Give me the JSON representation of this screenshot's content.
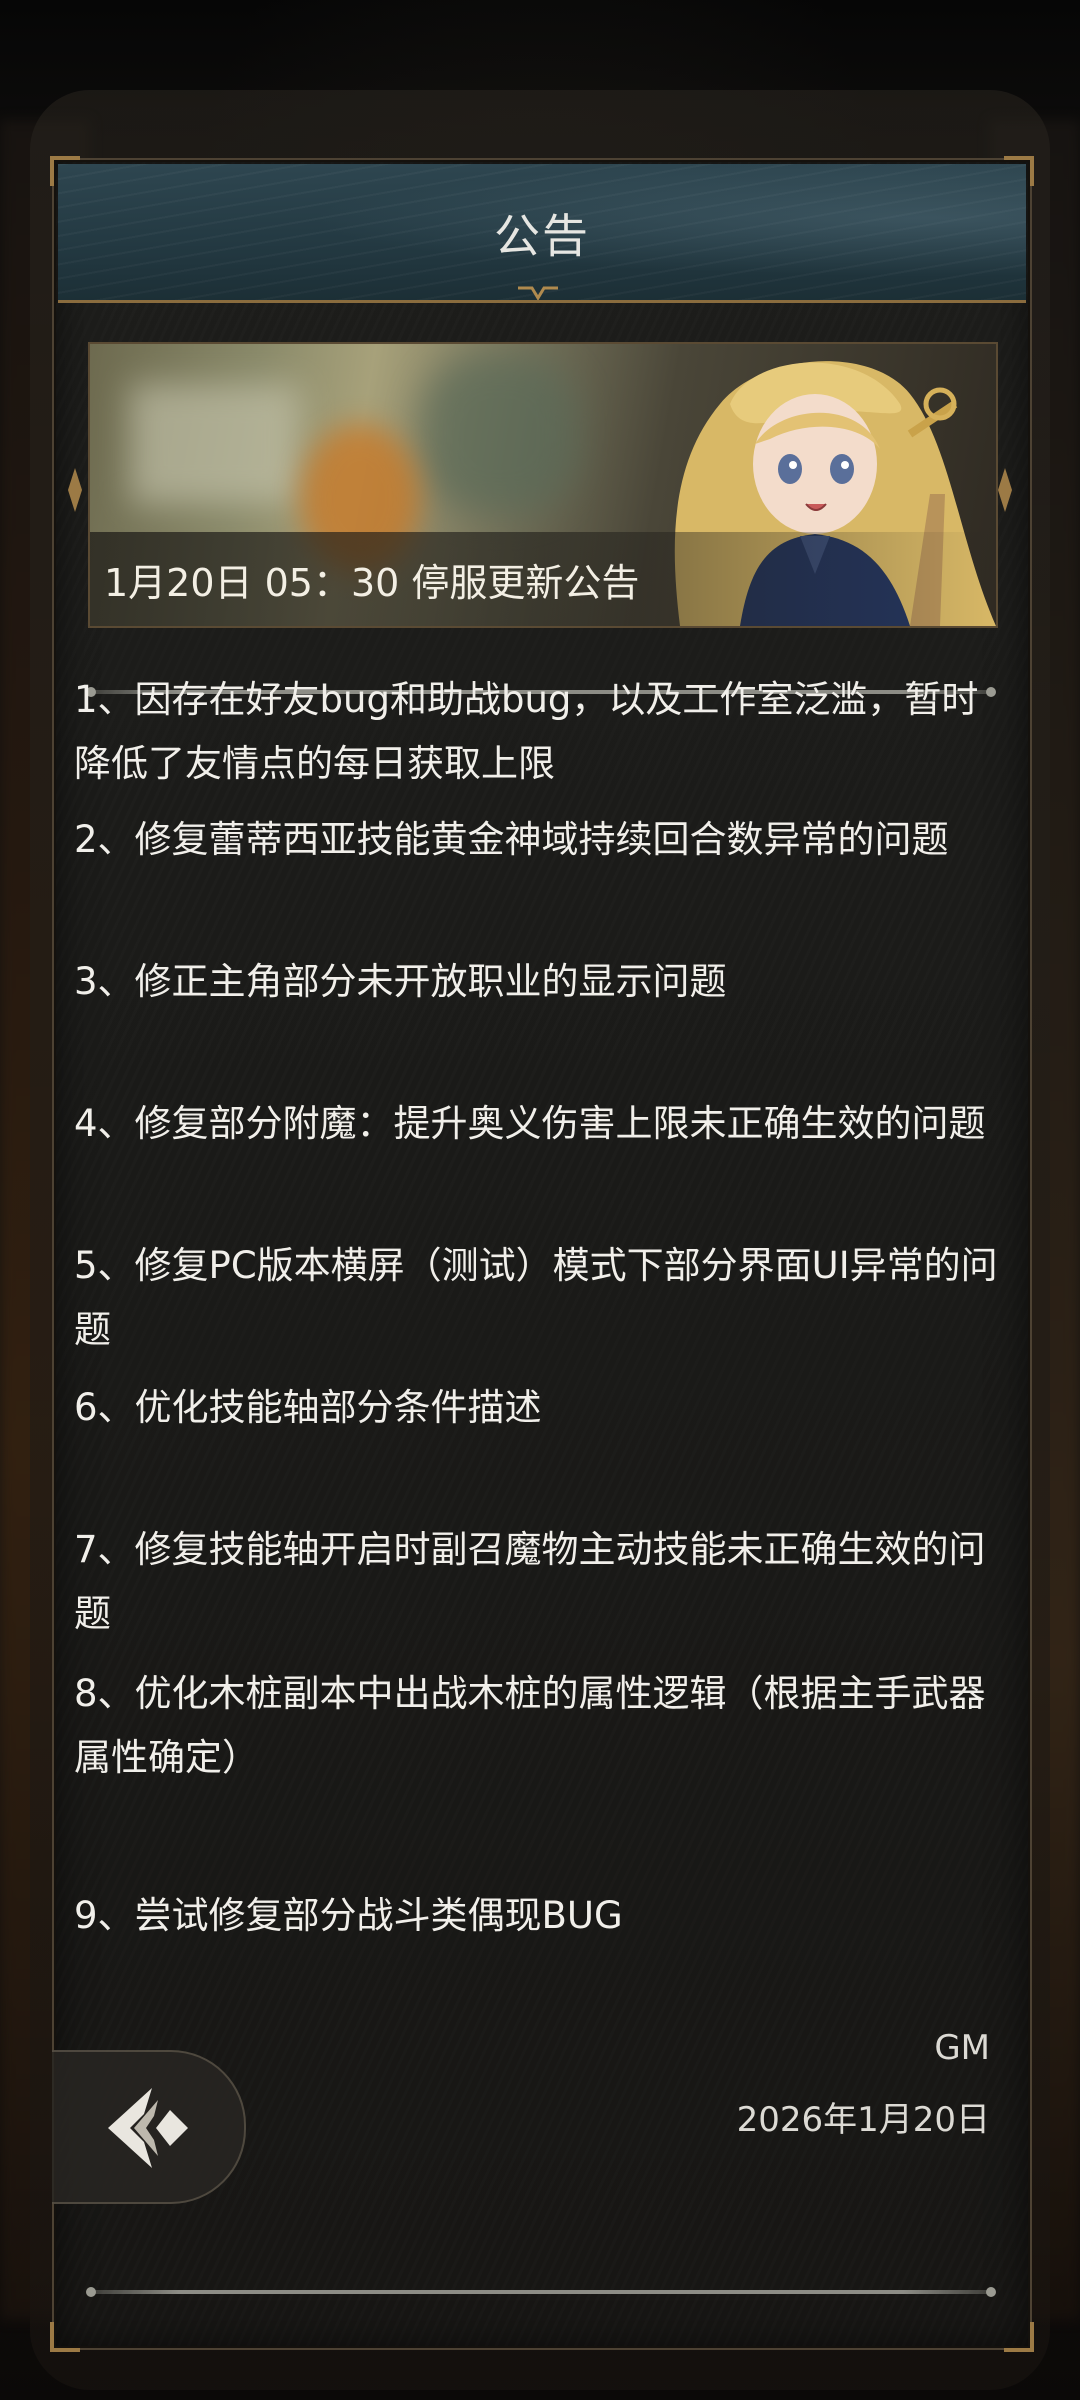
{
  "header": {
    "title": "公告"
  },
  "banner": {
    "caption": "1月20日 05：30 停服更新公告"
  },
  "notice": {
    "items": [
      "1、因存在好友bug和助战bug，以及工作室泛滥，暂时降低了友情点的每日获取上限",
      "2、修复蕾蒂西亚技能黄金神域持续回合数异常的问题",
      "3、修正主角部分未开放职业的显示问题",
      "4、修复部分附魔：提升奥义伤害上限未正确生效的问题",
      "5、修复PC版本横屏（测试）模式下部分界面UI异常的问题",
      "6、优化技能轴部分条件描述",
      "7、修复技能轴开启时副召魔物主动技能未正确生效的问题",
      "8、优化木桩副本中出战木桩的属性逻辑（根据主手武器属性确定）",
      "9、尝试修复部分战斗类偶现BUG"
    ],
    "signature": "GM",
    "date": "2026年1月20日"
  },
  "icons": {
    "back": "back-arrow-icon",
    "ornament": "gold-ornament-icon"
  },
  "colors": {
    "header_bg": "#2e4650",
    "frame_gold": "#9c7a45",
    "panel_bg": "#1a1a18",
    "text": "#f1efea"
  }
}
